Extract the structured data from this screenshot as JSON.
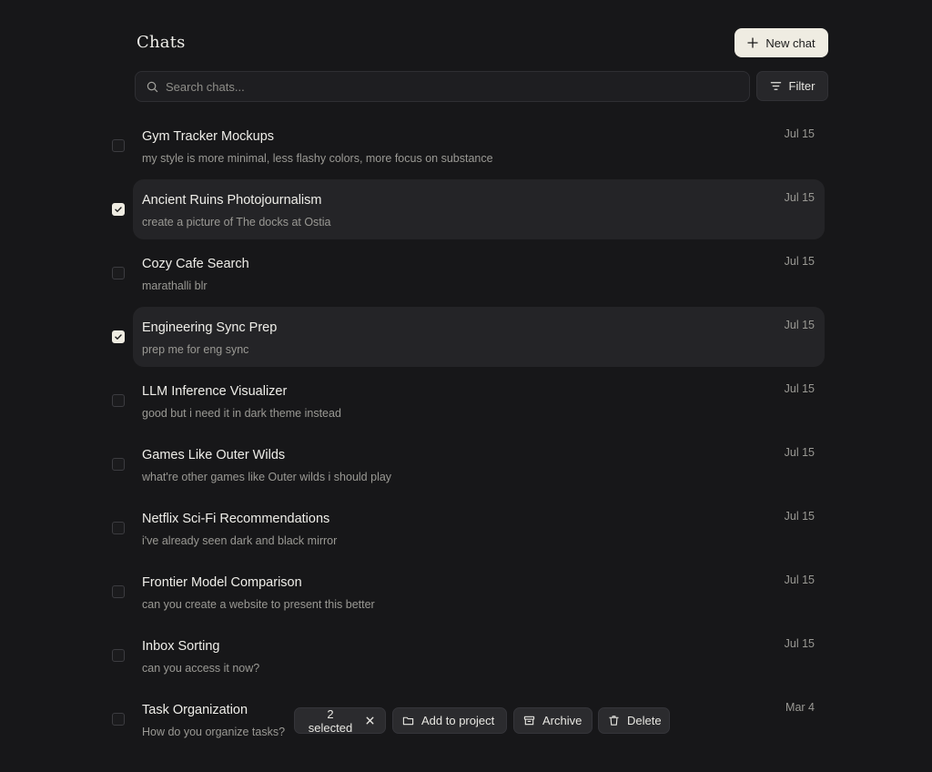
{
  "header": {
    "title": "Chats",
    "new_chat_label": "New chat"
  },
  "search": {
    "placeholder": "Search chats...",
    "value": ""
  },
  "filter": {
    "label": "Filter"
  },
  "chats": [
    {
      "title": "Gym Tracker Mockups",
      "preview": "my style is more minimal, less flashy colors, more focus on substance",
      "date": "Jul 15",
      "selected": false
    },
    {
      "title": "Ancient Ruins Photojournalism",
      "preview": "create a picture of The docks at Ostia",
      "date": "Jul 15",
      "selected": true
    },
    {
      "title": "Cozy Cafe Search",
      "preview": "marathalli blr",
      "date": "Jul 15",
      "selected": false
    },
    {
      "title": "Engineering Sync Prep",
      "preview": "prep me for eng sync",
      "date": "Jul 15",
      "selected": true
    },
    {
      "title": "LLM Inference Visualizer",
      "preview": "good but i need it in dark theme instead",
      "date": "Jul 15",
      "selected": false
    },
    {
      "title": "Games Like Outer Wilds",
      "preview": "what're other games like Outer wilds i should play",
      "date": "Jul 15",
      "selected": false
    },
    {
      "title": "Netflix Sci-Fi Recommendations",
      "preview": "i've already seen dark and black mirror",
      "date": "Jul 15",
      "selected": false
    },
    {
      "title": "Frontier Model Comparison",
      "preview": "can you create a website to present this better",
      "date": "Jul 15",
      "selected": false
    },
    {
      "title": "Inbox Sorting",
      "preview": "can you access it now?",
      "date": "Jul 15",
      "selected": false
    },
    {
      "title": "Task Organization",
      "preview": "How do you organize tasks?",
      "date": "Mar 4",
      "selected": false
    }
  ],
  "actions": {
    "selected_label": "2 selected",
    "add_to_project_label": "Add to project",
    "archive_label": "Archive",
    "delete_label": "Delete"
  },
  "icons": {
    "new_chat": "plus-icon",
    "search": "search-icon",
    "filter": "filter-icon",
    "checkbox": "check-icon",
    "clear_selection": "close-icon",
    "add_to_project": "folder-icon",
    "archive": "archive-icon",
    "delete": "trash-icon"
  },
  "colors": {
    "background": "#171719",
    "primary_button": "#efece2",
    "selected_row": "#242427"
  }
}
